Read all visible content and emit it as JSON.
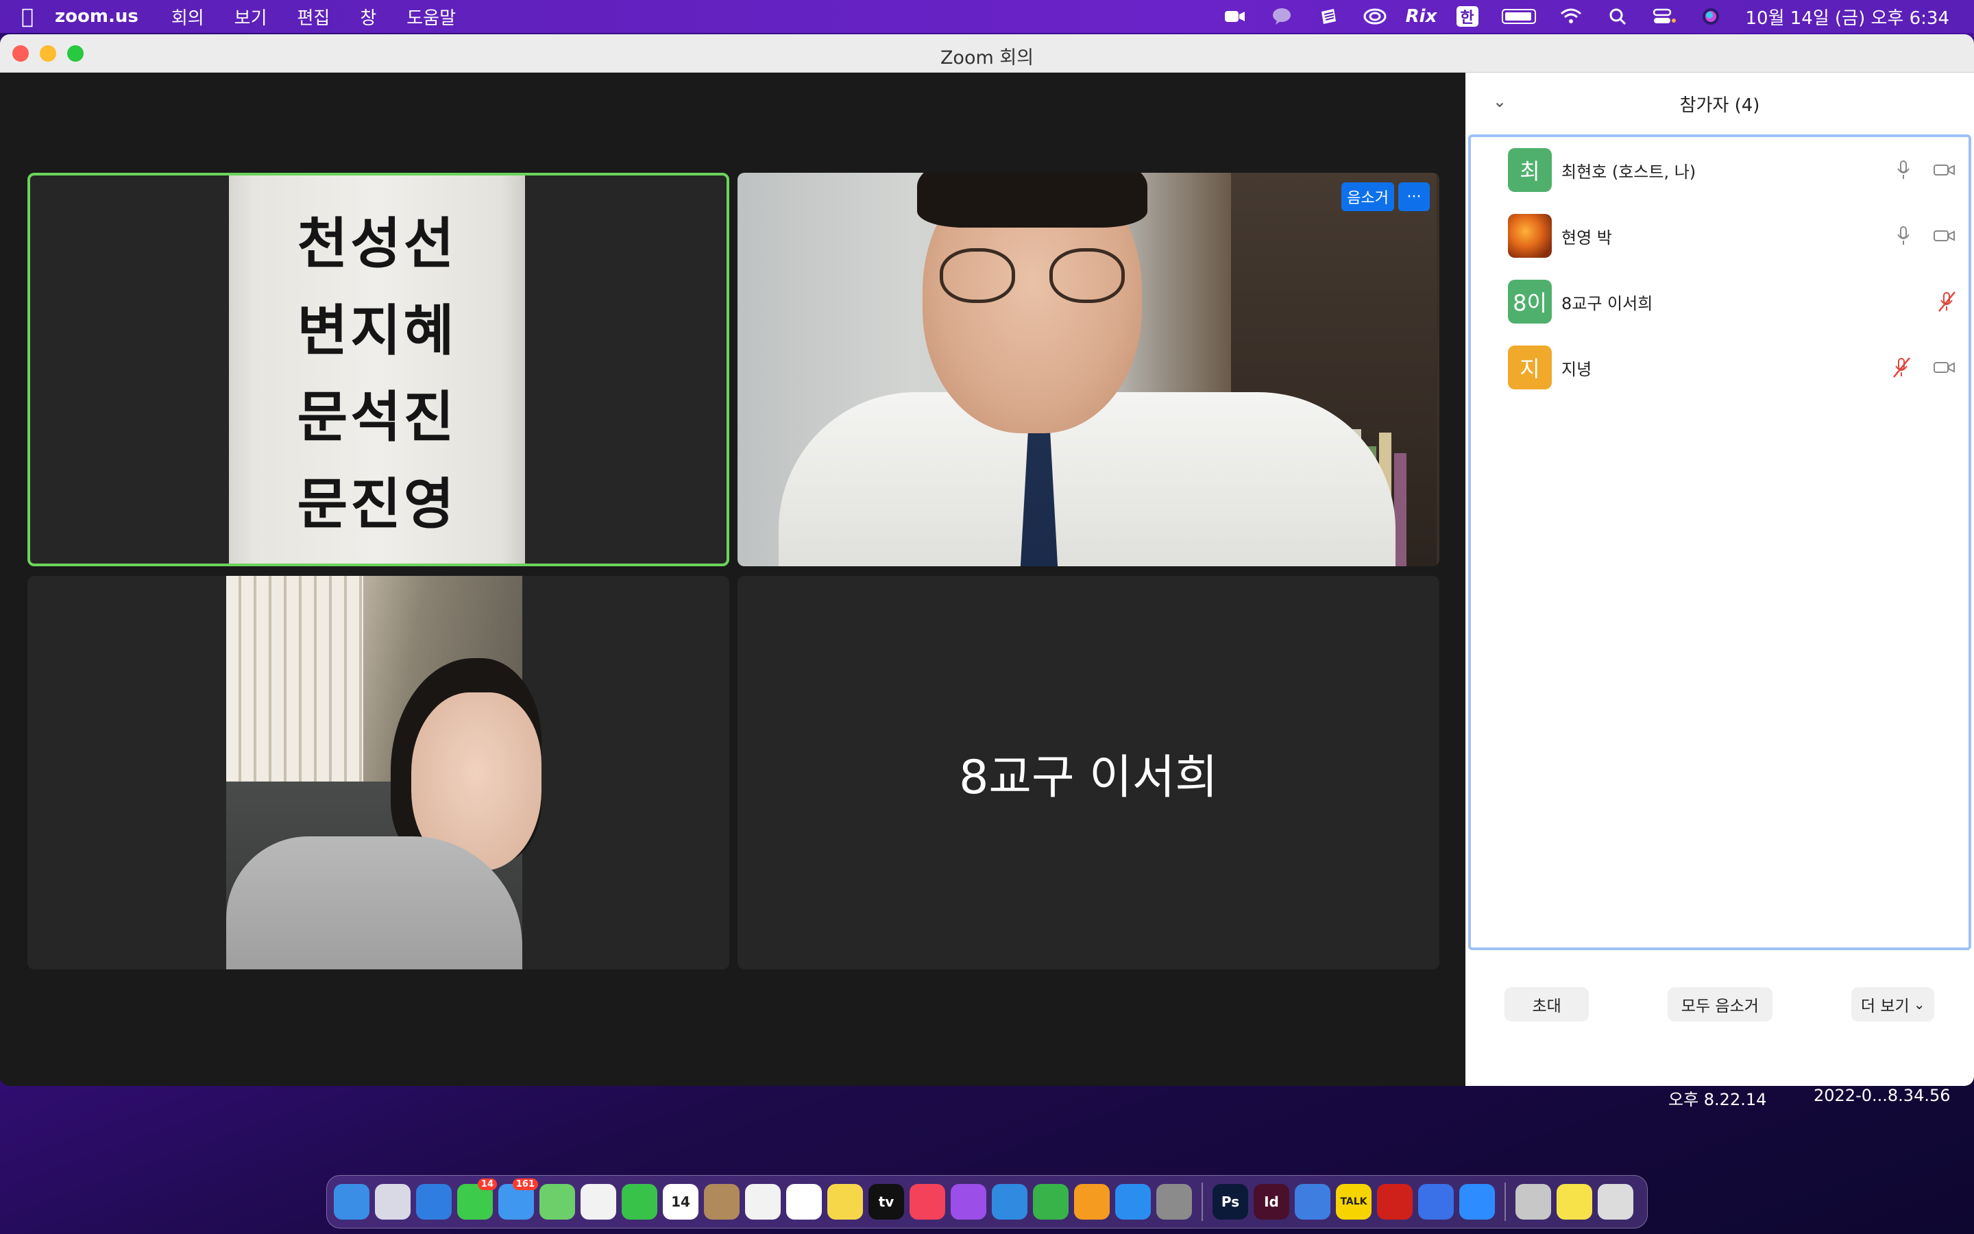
{
  "menubar": {
    "app_name": "zoom.us",
    "menus": [
      "회의",
      "보기",
      "편집",
      "창",
      "도움말"
    ],
    "status_icons": [
      "zoom-icon",
      "chat-bubble-icon",
      "notes-icon",
      "creative-cloud-icon",
      "rix-icon",
      "korean-input-icon",
      "battery-icon",
      "wifi-icon",
      "search-icon",
      "control-center-icon",
      "siri-icon"
    ],
    "rix_label": "Rix",
    "input_label": "한",
    "clock": "10월 14일 (금) 오후 6:34"
  },
  "window": {
    "title": "Zoom 회의"
  },
  "video_tiles": [
    {
      "type": "video",
      "sign_names": [
        "천성선",
        "변지혜",
        "문석진",
        "문진영"
      ],
      "active_speaker": true
    },
    {
      "type": "video",
      "badges": {
        "mute_label": "음소거",
        "more_label": "···"
      }
    },
    {
      "type": "video"
    },
    {
      "type": "name",
      "display_name": "8교구 이서희"
    }
  ],
  "participants_panel": {
    "title": "참가자 (4)",
    "participants": [
      {
        "initial": "최",
        "name": "최현호 (호스트, 나)",
        "avatar_color": "#4fb06d",
        "mic": "on",
        "video": "off"
      },
      {
        "initial": "",
        "name": "현영 박",
        "avatar_color": "photo",
        "mic": "on",
        "video": "off"
      },
      {
        "initial": "8이",
        "name": "8교구 이서희",
        "avatar_color": "#4fb06d",
        "mic": "muted",
        "video": "none"
      },
      {
        "initial": "지",
        "name": "지녕",
        "avatar_color": "#f0a92a",
        "mic": "muted",
        "video": "off"
      }
    ],
    "buttons": {
      "invite": "초대",
      "mute_all": "모두 음소거",
      "more": "더 보기"
    }
  },
  "desktop": {
    "captions": [
      "오후 8.22.14",
      "2022-0...8.34.56"
    ]
  },
  "dock": {
    "apps": [
      {
        "name": "finder-icon",
        "color": "#3a8ee6"
      },
      {
        "name": "launchpad-icon",
        "color": "#d9d9e6"
      },
      {
        "name": "safari-icon",
        "color": "#2f7de0"
      },
      {
        "name": "messages-icon",
        "color": "#3ccb4a",
        "badge": "14"
      },
      {
        "name": "mail-icon",
        "color": "#3f97f0",
        "badge": "161"
      },
      {
        "name": "maps-icon",
        "color": "#6ccf6a"
      },
      {
        "name": "photos-icon",
        "color": "#f2f2f2"
      },
      {
        "name": "facetime-icon",
        "color": "#39c24a"
      },
      {
        "name": "calendar-icon",
        "color": "#ffffff",
        "label": "14"
      },
      {
        "name": "contacts-icon",
        "color": "#b08a5a"
      },
      {
        "name": "chrome-icon",
        "color": "#f2f2f2"
      },
      {
        "name": "reminders-icon",
        "color": "#ffffff"
      },
      {
        "name": "notes-icon",
        "color": "#f7d74a"
      },
      {
        "name": "apple-tv-icon",
        "color": "#111111",
        "label": "tv"
      },
      {
        "name": "music-icon",
        "color": "#f4425a"
      },
      {
        "name": "podcasts-icon",
        "color": "#9b4ee8"
      },
      {
        "name": "keynote-icon",
        "color": "#2f8ae0"
      },
      {
        "name": "numbers-icon",
        "color": "#37b34a"
      },
      {
        "name": "pages-icon",
        "color": "#f59b1f"
      },
      {
        "name": "app-store-icon",
        "color": "#2c8df0"
      },
      {
        "name": "system-preferences-icon",
        "color": "#8b8b8b"
      },
      {
        "name": "photoshop-icon",
        "color": "#0c1a3a",
        "label": "Ps"
      },
      {
        "name": "indesign-icon",
        "color": "#4a0f2a",
        "label": "Id"
      },
      {
        "name": "stickies-icon",
        "color": "#3e7ee0"
      },
      {
        "name": "kakaotalk-icon",
        "color": "#f7d400",
        "label": "TALK"
      },
      {
        "name": "acrobat-icon",
        "color": "#d0201a"
      },
      {
        "name": "teams-chat-icon",
        "color": "#3a70e8"
      },
      {
        "name": "zoom-icon",
        "color": "#2d8cff"
      },
      {
        "name": "downloads-icon",
        "color": "#c7c7c7"
      },
      {
        "name": "folder-icon",
        "color": "#f7e24a"
      },
      {
        "name": "trash-icon",
        "color": "#dcdcdc"
      }
    ]
  }
}
